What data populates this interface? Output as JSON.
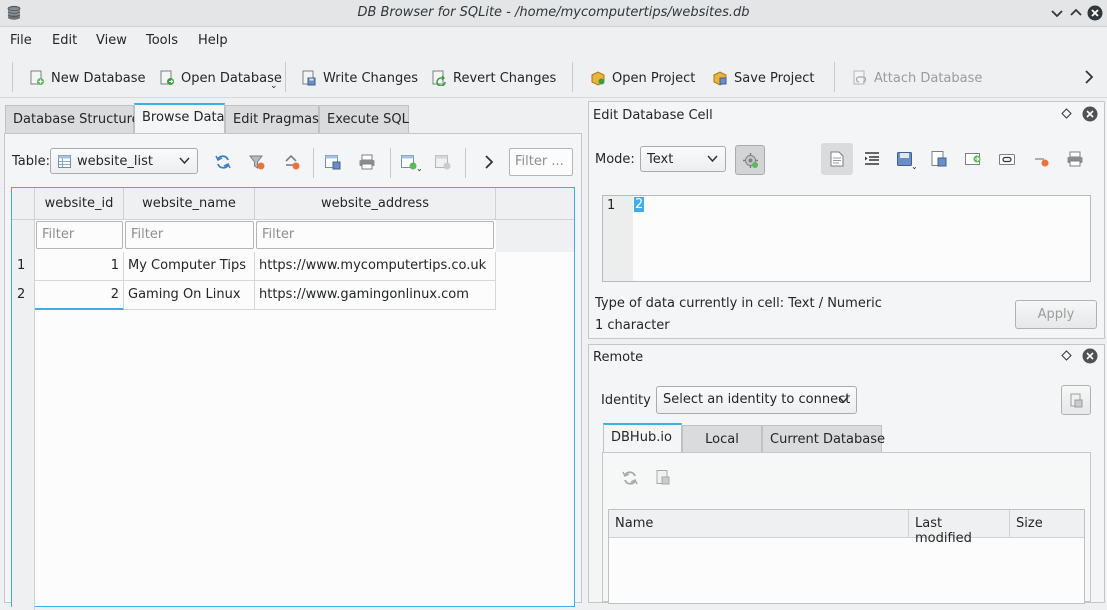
{
  "window": {
    "title": "DB Browser for SQLite - /home/mycomputertips/websites.db"
  },
  "menu": [
    "File",
    "Edit",
    "View",
    "Tools",
    "Help"
  ],
  "toolbar": {
    "new_database": "New Database",
    "open_database": "Open Database",
    "write_changes": "Write Changes",
    "revert_changes": "Revert Changes",
    "open_project": "Open Project",
    "save_project": "Save Project",
    "attach_database": "Attach Database"
  },
  "tabs": [
    "Database Structure",
    "Browse Data",
    "Edit Pragmas",
    "Execute SQL"
  ],
  "browse": {
    "table_label": "Table:",
    "table_value": "website_list",
    "filter_placeholder": "Filter ...",
    "columns": [
      "website_id",
      "website_name",
      "website_address"
    ],
    "column_filter": "Filter",
    "rows": [
      {
        "row": "1",
        "id": "1",
        "name": "My Computer Tips",
        "address": "https://www.mycomputertips.co.uk"
      },
      {
        "row": "2",
        "id": "2",
        "name": "Gaming On Linux",
        "address": "https://www.gamingonlinux.com"
      }
    ]
  },
  "edit_cell": {
    "title": "Edit Database Cell",
    "mode_label": "Mode:",
    "mode_value": "Text",
    "line_number": "1",
    "content": "2",
    "type_info": "Type of data currently in cell: Text / Numeric",
    "size_info": "1 character",
    "apply": "Apply"
  },
  "remote": {
    "title": "Remote",
    "identity_label": "Identity",
    "identity_value": "Select an identity to connect",
    "tabs": [
      "DBHub.io",
      "Local",
      "Current Database"
    ],
    "columns": [
      "Name",
      "Last modified",
      "Size"
    ]
  },
  "colors": {
    "accent": "#3daee9",
    "background": "#eff0f1"
  }
}
